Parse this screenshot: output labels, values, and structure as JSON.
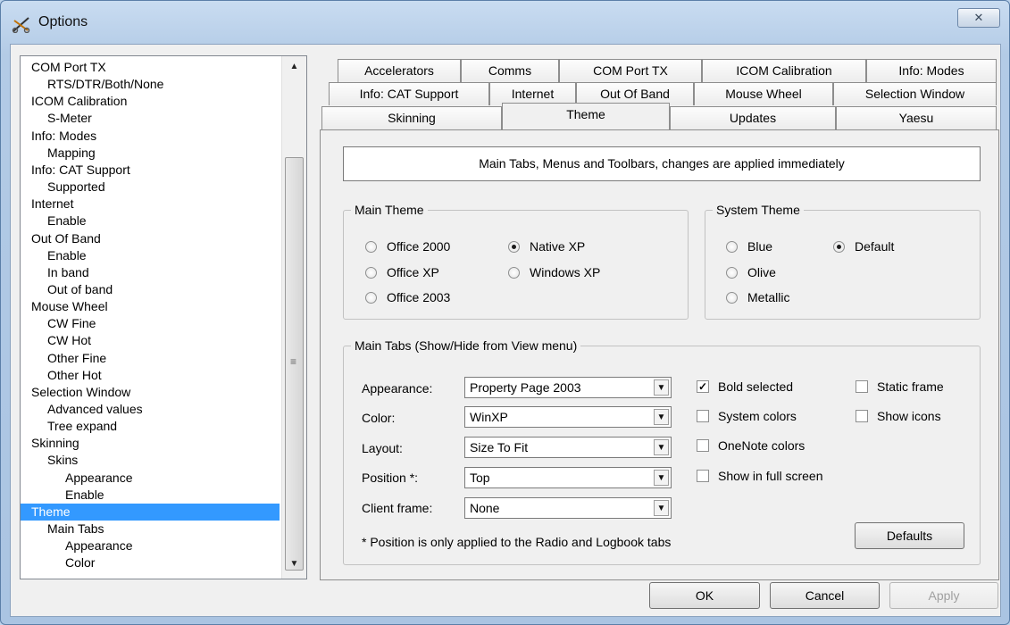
{
  "window": {
    "title": "Options",
    "close_label": "✕",
    "app_icon": "scissors-icon"
  },
  "tree": {
    "items": [
      {
        "label": "COM Port TX",
        "level": 0
      },
      {
        "label": "RTS/DTR/Both/None",
        "level": 1
      },
      {
        "label": "ICOM Calibration",
        "level": 0
      },
      {
        "label": "S-Meter",
        "level": 1
      },
      {
        "label": "Info: Modes",
        "level": 0
      },
      {
        "label": "Mapping",
        "level": 1
      },
      {
        "label": "Info: CAT Support",
        "level": 0
      },
      {
        "label": "Supported",
        "level": 1
      },
      {
        "label": "Internet",
        "level": 0
      },
      {
        "label": "Enable",
        "level": 1
      },
      {
        "label": "Out Of Band",
        "level": 0
      },
      {
        "label": "Enable",
        "level": 1
      },
      {
        "label": "In band",
        "level": 1
      },
      {
        "label": "Out of band",
        "level": 1
      },
      {
        "label": "Mouse Wheel",
        "level": 0
      },
      {
        "label": "CW Fine",
        "level": 1
      },
      {
        "label": "CW Hot",
        "level": 1
      },
      {
        "label": "Other Fine",
        "level": 1
      },
      {
        "label": "Other Hot",
        "level": 1
      },
      {
        "label": "Selection Window",
        "level": 0
      },
      {
        "label": "Advanced values",
        "level": 1
      },
      {
        "label": "Tree expand",
        "level": 1
      },
      {
        "label": "Skinning",
        "level": 0
      },
      {
        "label": "Skins",
        "level": 1
      },
      {
        "label": "Appearance",
        "level": 2
      },
      {
        "label": "Enable",
        "level": 2
      },
      {
        "label": "Theme",
        "level": 0,
        "selected": true
      },
      {
        "label": "Main Tabs",
        "level": 1
      },
      {
        "label": "Appearance",
        "level": 2
      },
      {
        "label": "Color",
        "level": 2
      }
    ]
  },
  "tabs": {
    "row1": [
      "Accelerators",
      "Comms",
      "COM Port TX",
      "ICOM Calibration",
      "Info: Modes"
    ],
    "row2": [
      "Info: CAT Support",
      "Internet",
      "Out Of Band",
      "Mouse Wheel",
      "Selection Window"
    ],
    "row3": [
      "Skinning",
      "Theme",
      "Updates",
      "Yaesu"
    ],
    "active": "Theme"
  },
  "theme_page": {
    "info_text": "Main Tabs, Menus and Toolbars, changes are applied immediately",
    "main_theme": {
      "label": "Main Theme",
      "options": [
        "Office 2000",
        "Native XP",
        "Office XP",
        "Windows XP",
        "Office 2003"
      ],
      "selected": "Native XP"
    },
    "system_theme": {
      "label": "System Theme",
      "options": [
        "Blue",
        "Default",
        "Olive",
        "Metallic"
      ],
      "selected": "Default"
    },
    "main_tabs": {
      "label": "Main Tabs (Show/Hide from View menu)",
      "fields": [
        {
          "label": "Appearance:",
          "value": "Property Page 2003"
        },
        {
          "label": "Color:",
          "value": "WinXP"
        },
        {
          "label": "Layout:",
          "value": "Size To Fit"
        },
        {
          "label": "Position *:",
          "value": "Top"
        },
        {
          "label": "Client frame:",
          "value": "None"
        }
      ],
      "checkboxes": [
        {
          "label": "Bold selected",
          "checked": true
        },
        {
          "label": "Static frame",
          "checked": false
        },
        {
          "label": "System colors",
          "checked": false
        },
        {
          "label": "Show icons",
          "checked": false
        },
        {
          "label": "OneNote colors",
          "checked": false
        },
        {
          "label": "Show in full screen",
          "checked": false
        }
      ],
      "note": "* Position is only applied to the Radio and Logbook tabs",
      "defaults_label": "Defaults"
    }
  },
  "buttons": {
    "ok": "OK",
    "cancel": "Cancel",
    "apply": "Apply"
  },
  "colors": {
    "selection": "#3399ff",
    "title_gradient": "#c9dcf1"
  }
}
